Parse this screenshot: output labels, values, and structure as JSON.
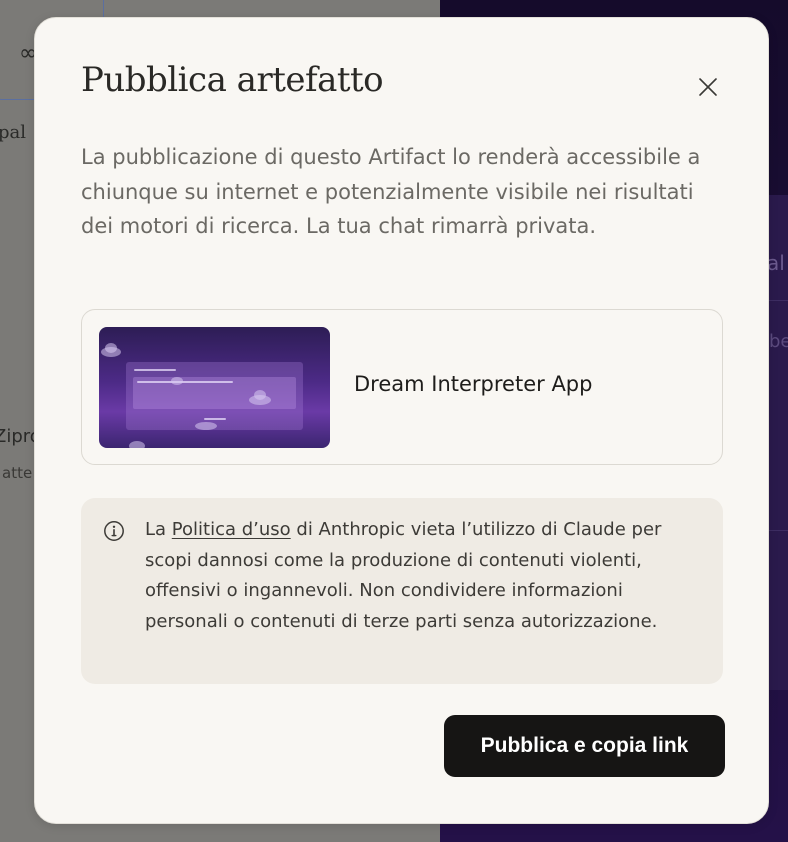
{
  "background": {
    "left_text_1": "pal",
    "left_text_2": "Zipro",
    "left_text_3": "atte",
    "right_text_1": "al",
    "right_text_2": "be"
  },
  "modal": {
    "title": "Pubblica artefatto",
    "close_label": "×",
    "description": "La pubblicazione di questo Artifact lo renderà accessibile a chiunque su internet e potenzialmente visibile nei risultati dei motori di ricerca. La tua chat rimarrà privata.",
    "artifact": {
      "name": "Dream Interpreter App",
      "thumbnail_colors": [
        "#2d1d55",
        "#6a3aa6"
      ]
    },
    "notice": {
      "prefix": "La ",
      "link_text": "Politica d’uso",
      "suffix": " di Anthropic vieta l’utilizzo di Claude per scopi dannosi come la produzione di contenuti violenti, offensivi o ingannevoli. Non condividere informazioni personali o contenuti di terze parti senza autorizzazione."
    },
    "publish_button_label": "Pubblica e copia link"
  },
  "icons": {
    "close": "close-icon",
    "info": "info-icon",
    "link_pill": "link-icon"
  },
  "colors": {
    "modal_bg": "#f9f7f3",
    "button_bg": "#161514",
    "notice_bg": "#efebe4",
    "text_primary": "#2a2926",
    "text_muted": "#6b6964"
  }
}
